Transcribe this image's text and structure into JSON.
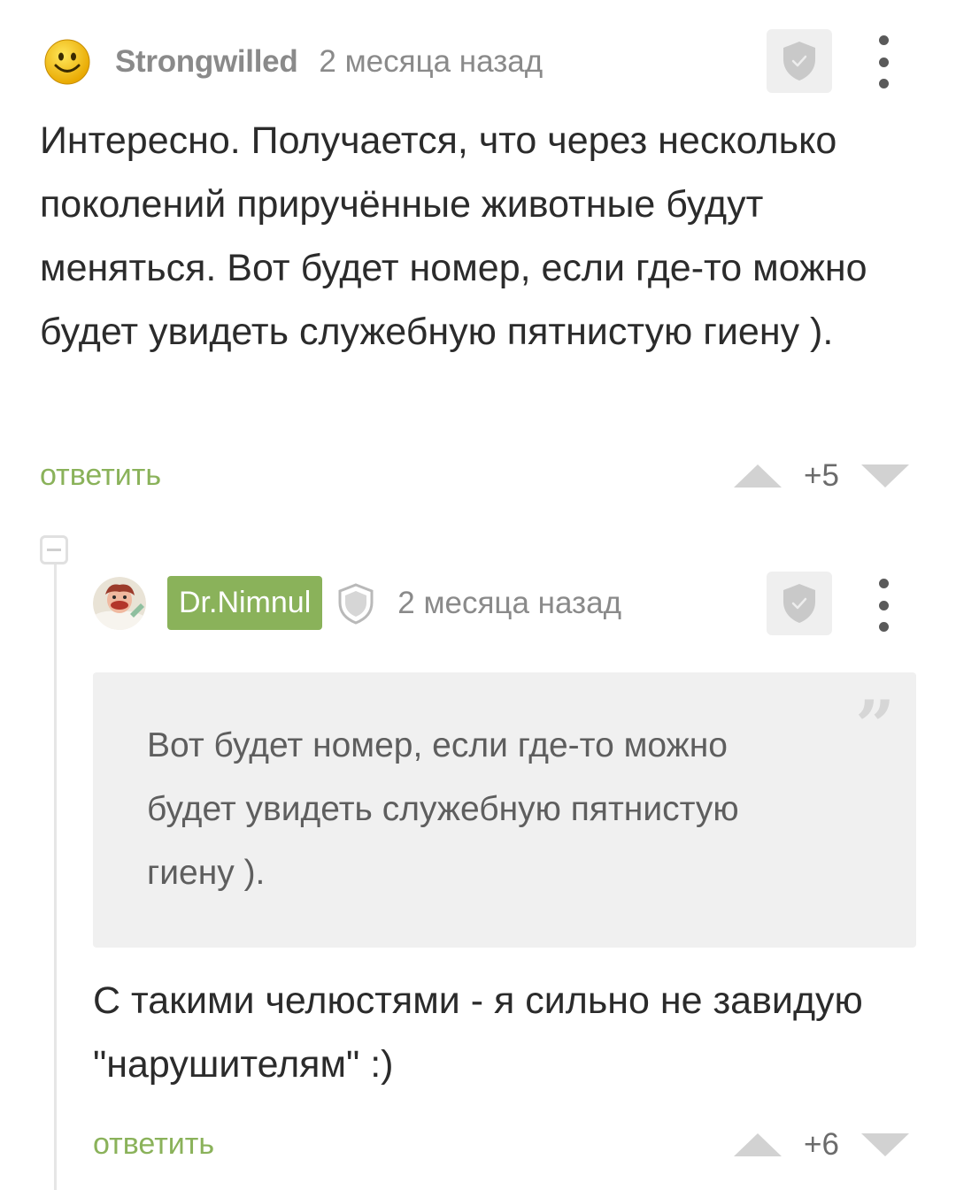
{
  "comment1": {
    "username": "Strongwilled",
    "timestamp": "2 месяца назад",
    "avatar_icon": "smiley-avatar",
    "text": "Интересно. Получается, что через несколько поколений приручённые животные будут меняться. Вот будет номер, если где-то можно будет увидеть служебную пятнистую гиену ).",
    "reply_label": "ответить",
    "rating": "+5"
  },
  "comment2": {
    "username": "Dr.Nimnul",
    "timestamp": "2 месяца назад",
    "avatar_icon": "cartoon-scientist-avatar",
    "quote": "Вот будет номер, если где-то можно будет увидеть служебную пятнистую гиену ).",
    "quote_mark": "”",
    "text": "С такими челюстями - я сильно не завидую \"нарушителям\" :)",
    "reply_label": "ответить",
    "rating": "+6"
  },
  "colors": {
    "accent_green": "#8ab25a",
    "text_dark": "#2b2b2b",
    "text_muted": "#8a8a8a",
    "quote_background": "#f0f0f0"
  }
}
